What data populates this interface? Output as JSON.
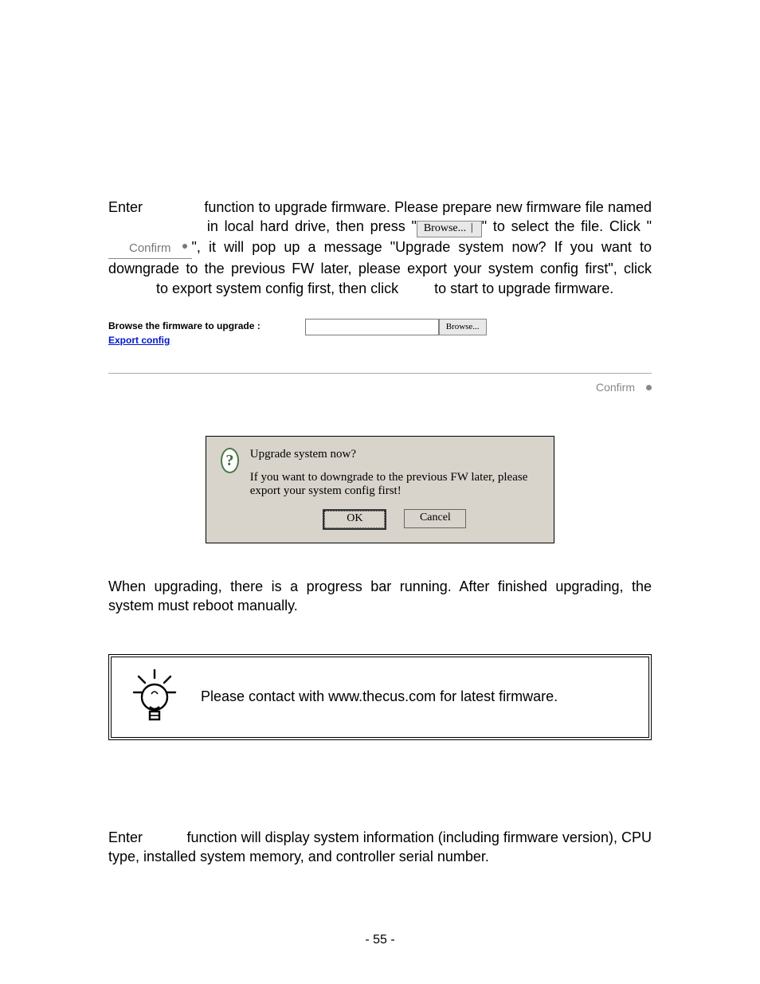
{
  "para1": {
    "t1": "Enter",
    "t2": "function to upgrade firmware. Please prepare new firmware file named",
    "t3": "in local hard drive, then press \"",
    "browse_inline": "Browse...",
    "t4": "\" to select the file. Click \"",
    "confirm_inline": "Confirm",
    "t5": "\", it will pop up a message \"Upgrade system now? If you want to downgrade to the previous FW later, please export your system config first\", click",
    "t6": "to export system config first, then click",
    "t7": "to start to upgrade firmware."
  },
  "shot1": {
    "label": "Browse the firmware to upgrade :",
    "export_link": "Export config",
    "browse_btn": "Browse...",
    "confirm_btn": "Confirm"
  },
  "dialog": {
    "title": "Upgrade system now?",
    "body": "If you want to downgrade to the previous FW later, please export your system config first!",
    "ok": "OK",
    "cancel": "Cancel"
  },
  "para_after_dialog": "When upgrading, there is a progress bar running. After finished upgrading, the system must reboot manually.",
  "tip": "Please contact with www.thecus.com for latest firmware.",
  "para2": {
    "t1": "Enter",
    "t2": "function will display system information (including firmware version), CPU type, installed system memory, and controller serial number."
  },
  "page_number": "- 55 -"
}
